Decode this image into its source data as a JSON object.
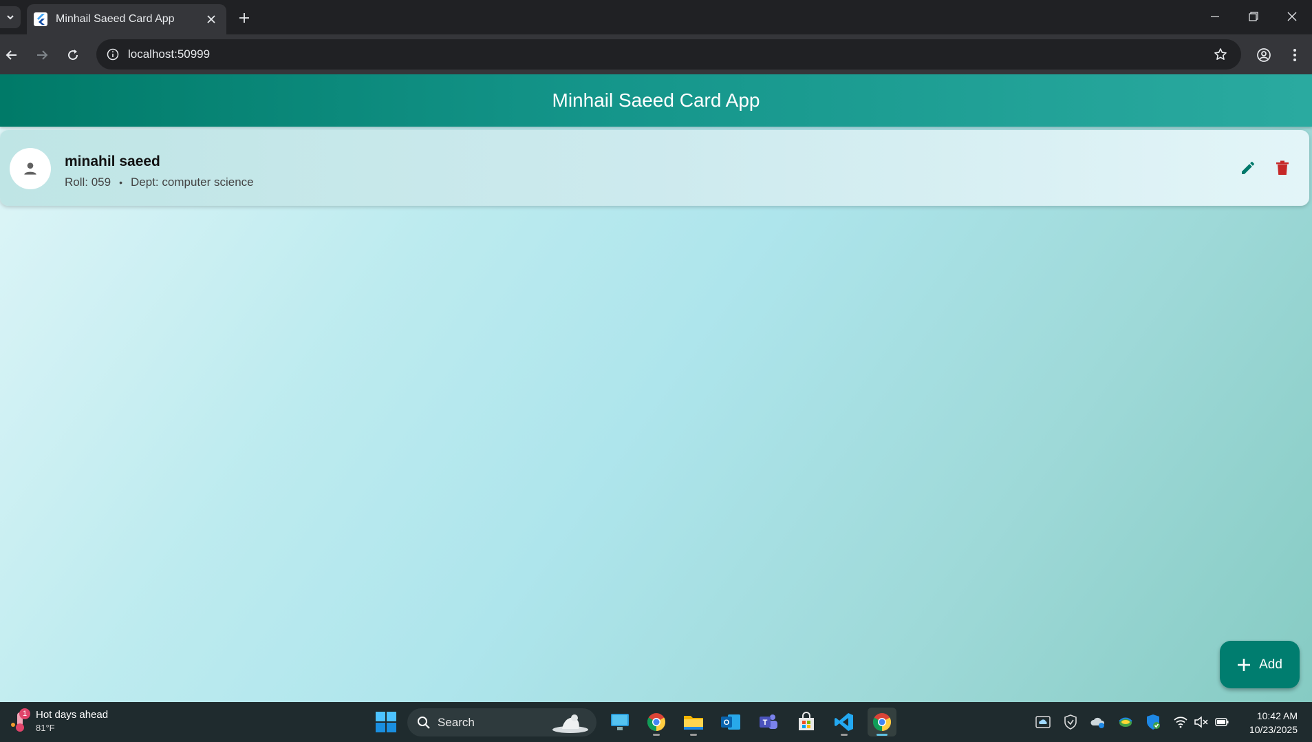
{
  "browser": {
    "tab_title": "Minhail Saeed Card App",
    "url": "localhost:50999"
  },
  "app": {
    "title": "Minhail Saeed Card App",
    "cards": [
      {
        "name": "minahil saeed",
        "roll": "Roll: 059",
        "dept": "Dept: computer science"
      }
    ],
    "fab_label": "Add",
    "colors": {
      "primary": "#007d6f",
      "delete": "#c62828",
      "edit": "#00796b"
    }
  },
  "taskbar": {
    "weather_title": "Hot days ahead",
    "weather_temp": "81°F",
    "weather_badge": "1",
    "search_label": "Search",
    "time": "10:42 AM",
    "date": "10/23/2025"
  }
}
